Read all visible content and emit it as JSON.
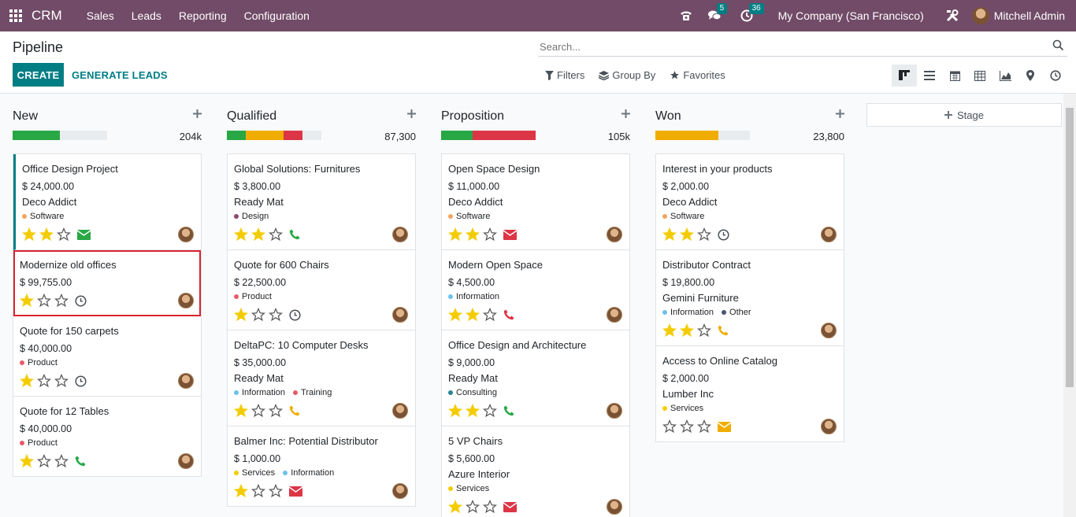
{
  "navbar": {
    "brand": "CRM",
    "menu": [
      "Sales",
      "Leads",
      "Reporting",
      "Configuration"
    ],
    "messages_count": "5",
    "activities_count": "36",
    "company": "My Company (San Francisco)",
    "user": "Mitchell Admin"
  },
  "control": {
    "title": "Pipeline",
    "create_label": "CREATE",
    "generate_label": "GENERATE LEADS",
    "search_placeholder": "Search...",
    "filters_label": "Filters",
    "groupby_label": "Group By",
    "favorites_label": "Favorites"
  },
  "colors": {
    "primary": "#714b67",
    "accent": "#017e84",
    "green": "#28a745",
    "orange": "#f0ad00",
    "red": "#dc3545",
    "star": "#f3cc00"
  },
  "stage_button": "Stage",
  "columns": [
    {
      "title": "New",
      "total": "204k",
      "progress": [
        {
          "color": "#28a745",
          "pct": 50
        }
      ],
      "cards": [
        {
          "name": "Office Design Project",
          "amount": "$ 24,000.00",
          "partner": "Deco Addict",
          "tags": [
            {
              "label": "Software",
              "color": "#f4a460"
            }
          ],
          "stars": 2,
          "activity": "email",
          "activity_color": "#28a745"
        },
        {
          "name": "Modernize old offices",
          "amount": "$ 99,755.00",
          "partner": "",
          "tags": [],
          "stars": 1,
          "activity": "clock",
          "activity_color": "#495057"
        },
        {
          "name": "Quote for 150 carpets",
          "amount": "$ 40,000.00",
          "partner": "",
          "tags": [
            {
              "label": "Product",
              "color": "#e85b68"
            }
          ],
          "stars": 1,
          "activity": "clock",
          "activity_color": "#495057"
        },
        {
          "name": "Quote for 12 Tables",
          "amount": "$ 40,000.00",
          "partner": "",
          "tags": [
            {
              "label": "Product",
              "color": "#e85b68"
            }
          ],
          "stars": 1,
          "activity": "phone",
          "activity_color": "#28a745"
        }
      ]
    },
    {
      "title": "Qualified",
      "total": "87,300",
      "progress": [
        {
          "color": "#28a745",
          "pct": 20
        },
        {
          "color": "#f0ad00",
          "pct": 40
        },
        {
          "color": "#dc3545",
          "pct": 20
        }
      ],
      "cards": [
        {
          "name": "Global Solutions: Furnitures",
          "amount": "$ 3,800.00",
          "partner": "Ready Mat",
          "tags": [
            {
              "label": "Design",
              "color": "#8b4a6b"
            }
          ],
          "stars": 2,
          "activity": "phone",
          "activity_color": "#28a745"
        },
        {
          "name": "Quote for 600 Chairs",
          "amount": "$ 22,500.00",
          "partner": "",
          "tags": [
            {
              "label": "Product",
              "color": "#e85b68"
            }
          ],
          "stars": 1,
          "activity": "clock",
          "activity_color": "#495057"
        },
        {
          "name": "DeltaPC: 10 Computer Desks",
          "amount": "$ 35,000.00",
          "partner": "Ready Mat",
          "tags": [
            {
              "label": "Information",
              "color": "#6cc1ed"
            },
            {
              "label": "Training",
              "color": "#e85b68"
            }
          ],
          "stars": 1,
          "activity": "phone",
          "activity_color": "#f0ad00"
        },
        {
          "name": "Balmer Inc: Potential Distributor",
          "amount": "$ 1,000.00",
          "partner": "",
          "tags": [
            {
              "label": "Services",
              "color": "#f3cc00"
            },
            {
              "label": "Information",
              "color": "#6cc1ed"
            }
          ],
          "stars": 1,
          "activity": "email",
          "activity_color": "#dc3545"
        }
      ]
    },
    {
      "title": "Proposition",
      "total": "105k",
      "progress": [
        {
          "color": "#28a745",
          "pct": 33
        },
        {
          "color": "#dc3545",
          "pct": 67
        }
      ],
      "cards": [
        {
          "name": "Open Space Design",
          "amount": "$ 11,000.00",
          "partner": "Deco Addict",
          "tags": [
            {
              "label": "Software",
              "color": "#f4a460"
            }
          ],
          "stars": 2,
          "activity": "email",
          "activity_color": "#dc3545"
        },
        {
          "name": "Modern Open Space",
          "amount": "$ 4,500.00",
          "partner": "",
          "tags": [
            {
              "label": "Information",
              "color": "#6cc1ed"
            }
          ],
          "stars": 2,
          "activity": "phone",
          "activity_color": "#dc3545"
        },
        {
          "name": "Office Design and Architecture",
          "amount": "$ 9,000.00",
          "partner": "Ready Mat",
          "tags": [
            {
              "label": "Consulting",
              "color": "#2c8397"
            }
          ],
          "stars": 2,
          "activity": "phone",
          "activity_color": "#28a745"
        },
        {
          "name": "5 VP Chairs",
          "amount": "$ 5,600.00",
          "partner": "Azure Interior",
          "tags": [
            {
              "label": "Services",
              "color": "#f3cc00"
            }
          ],
          "stars": 1,
          "activity": "email",
          "activity_color": "#dc3545"
        }
      ]
    },
    {
      "title": "Won",
      "total": "23,800",
      "progress": [
        {
          "color": "#f0ad00",
          "pct": 67
        }
      ],
      "cards": [
        {
          "name": "Interest in your products",
          "amount": "$ 2,000.00",
          "partner": "Deco Addict",
          "tags": [
            {
              "label": "Software",
              "color": "#f4a460"
            }
          ],
          "stars": 2,
          "activity": "clock",
          "activity_color": "#495057"
        },
        {
          "name": "Distributor Contract",
          "amount": "$ 19,800.00",
          "partner": "Gemini Furniture",
          "tags": [
            {
              "label": "Information",
              "color": "#6cc1ed"
            },
            {
              "label": "Other",
              "color": "#475577"
            }
          ],
          "stars": 2,
          "activity": "phone",
          "activity_color": "#f0ad00"
        },
        {
          "name": "Access to Online Catalog",
          "amount": "$ 2,000.00",
          "partner": "Lumber Inc",
          "tags": [
            {
              "label": "Services",
              "color": "#f3cc00"
            }
          ],
          "stars": 0,
          "activity": "email",
          "activity_color": "#f0ad00"
        }
      ]
    }
  ]
}
